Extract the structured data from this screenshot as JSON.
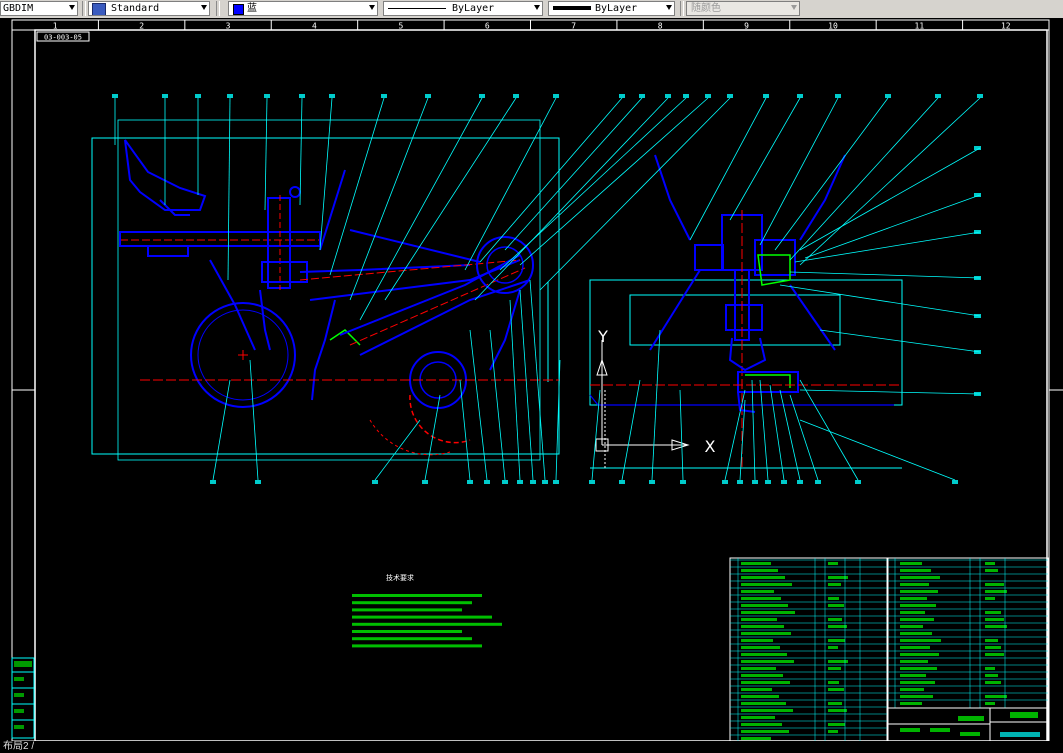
{
  "toolbar": {
    "dimstyle": "GBDIM",
    "textstyle": "Standard",
    "color": "蓝",
    "linetype": "ByLayer",
    "lineweight": "ByLayer",
    "plotstyle": "随颜色"
  },
  "ruler": {
    "columns": [
      "1",
      "2",
      "3",
      "4",
      "5",
      "6",
      "7",
      "8",
      "9",
      "10",
      "11",
      "12"
    ]
  },
  "drawing": {
    "badge": "03-003-05",
    "notes_title": "技术要求",
    "ucs_x": "X",
    "ucs_y": "Y"
  },
  "status": {
    "layout_tab": "布局2 /"
  },
  "colors": {
    "cyan": "#00ffff",
    "blue": "#0000ff",
    "red": "#ff0000",
    "white": "#ffffff",
    "green": "#00ff00"
  }
}
